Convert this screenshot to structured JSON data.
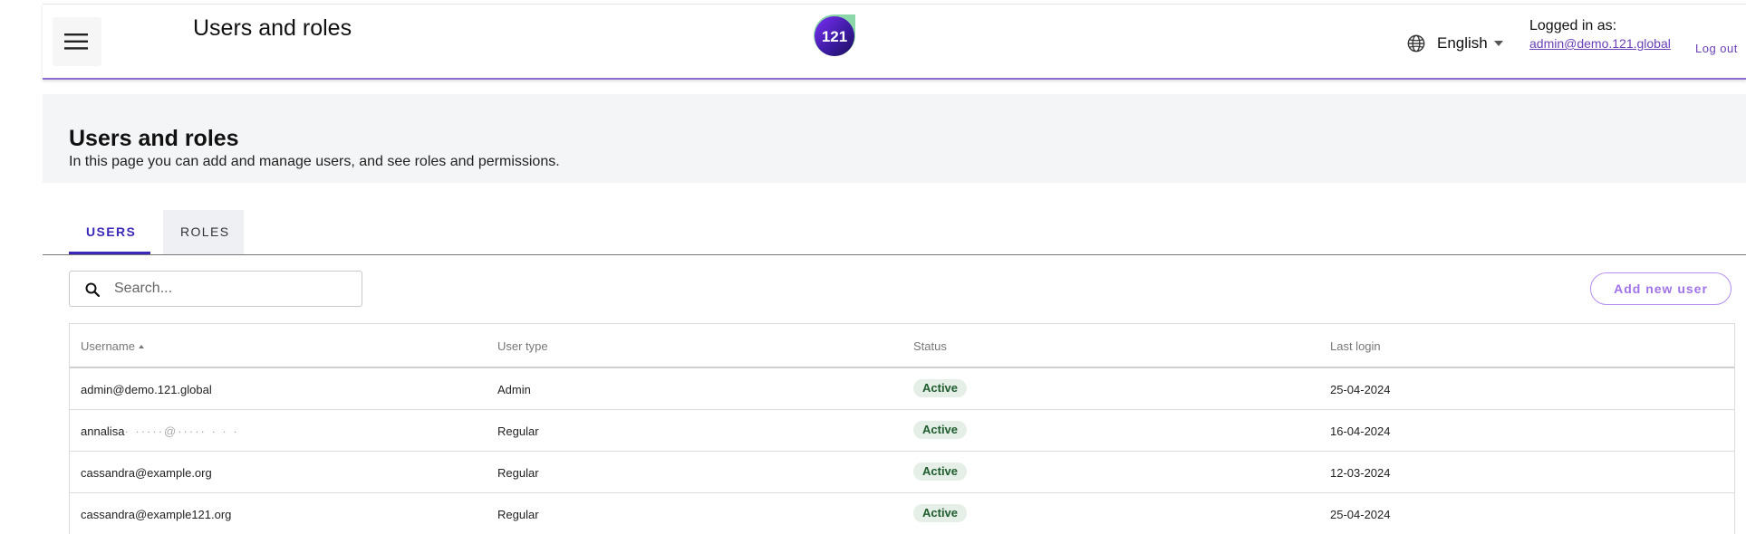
{
  "header": {
    "title": "Users and roles",
    "logo_text": "121",
    "language": "English",
    "logged_in_label": "Logged in as:",
    "logged_in_email": "admin@demo.121.global",
    "logout_label": "Log out"
  },
  "intro": {
    "heading": "Users and roles",
    "description": "In this page you can add and manage users, and see roles and permissions."
  },
  "tabs": [
    {
      "label": "USERS",
      "active": true
    },
    {
      "label": "ROLES",
      "active": false
    }
  ],
  "search": {
    "placeholder": "Search..."
  },
  "add_user_label": "Add new user",
  "table": {
    "columns": [
      "Username",
      "User type",
      "Status",
      "Last login"
    ],
    "sort_column": "Username",
    "rows": [
      {
        "username": "admin@demo.121.global",
        "user_type": "Admin",
        "status": "Active",
        "last_login": "25-04-2024"
      },
      {
        "username": "annalisa",
        "username_obscured": "·  ·····@·····  ·  ·  ·",
        "user_type": "Regular",
        "status": "Active",
        "last_login": "16-04-2024"
      },
      {
        "username": "cassandra@example.org",
        "user_type": "Regular",
        "status": "Active",
        "last_login": "12-03-2024"
      },
      {
        "username": "cassandra@example121.org",
        "user_type": "Regular",
        "status": "Active",
        "last_login": "25-04-2024"
      }
    ]
  },
  "colors": {
    "accent": "#3b2ab8",
    "header_rule": "#8e6bd0",
    "link": "#6a3fb8",
    "add_button": "#a173e8",
    "status_badge_bg": "#e5efe7",
    "status_badge_text": "#1e5c2e",
    "intro_bg": "#f4f5f7"
  },
  "icons": {
    "menu": "hamburger-menu-icon",
    "language": "globe-icon",
    "search": "search-icon",
    "sort": "sort-ascending-icon"
  }
}
